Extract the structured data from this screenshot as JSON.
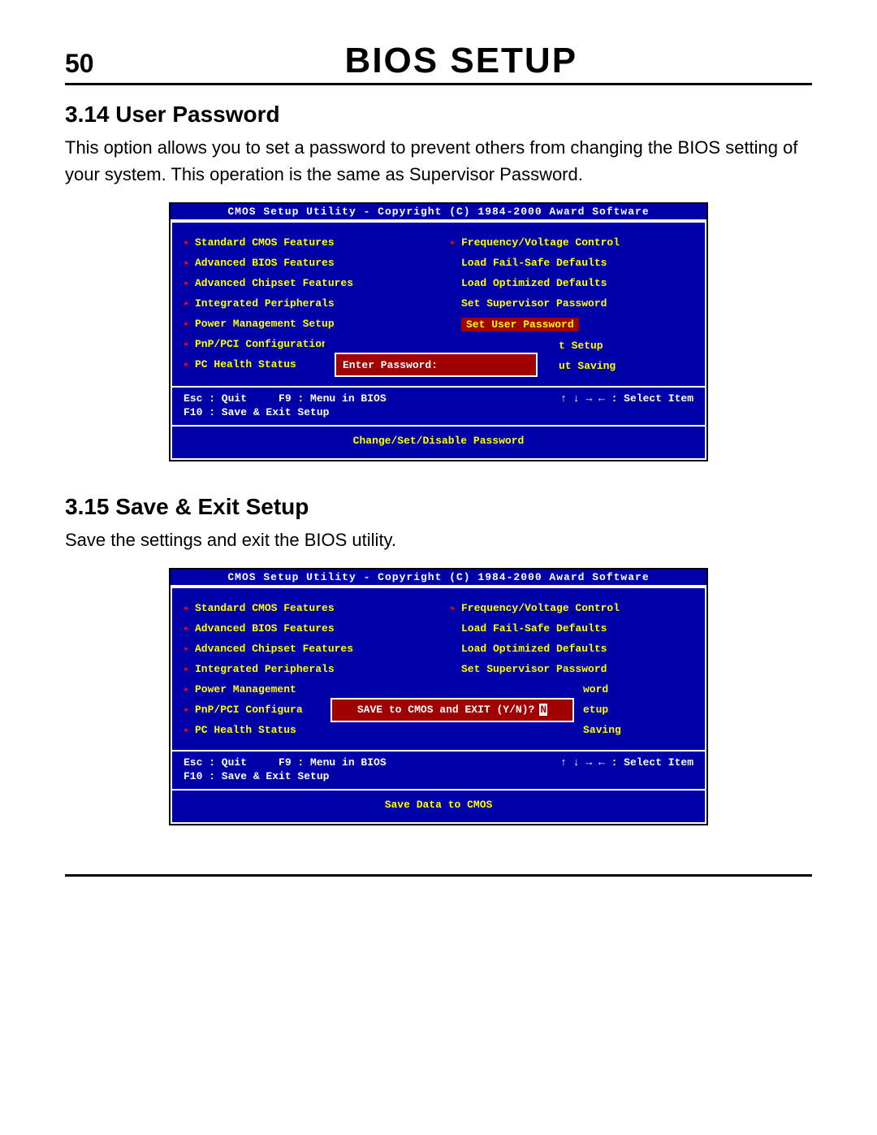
{
  "page": {
    "number": "50",
    "title": "BIOS SETUP"
  },
  "s314": {
    "title": "3.14 User Password",
    "body": "This option allows you to set a password to prevent others from changing the BIOS setting of your system. This operation is the same as Supervisor Password."
  },
  "s315": {
    "title": "3.15 Save & Exit Setup",
    "body": "Save the settings and exit the BIOS utility."
  },
  "bios": {
    "title": "CMOS Setup Utility - Copyright (C) 1984-2000 Award Software",
    "left": [
      "Standard CMOS Features",
      "Advanced BIOS Features",
      "Advanced Chipset Features",
      "Integrated Peripherals",
      "Power Management Setup",
      "PnP/PCI Configurations",
      "PC Health Status"
    ],
    "left_short5": "Power Management",
    "left_short6": "PnP/PCI Configura",
    "right": [
      "Frequency/Voltage Control",
      "Load Fail-Safe Defaults",
      "Load Optimized Defaults",
      "Set Supervisor Password",
      "Set User Password",
      "Save & Exit Setup",
      "Exit Without Saving"
    ],
    "right_trunc": {
      "r5": "t Setup",
      "r6": "ut Saving",
      "r4b": "word",
      "r5b": "etup",
      "r6b": "aving"
    },
    "keys": {
      "left": "Esc : Quit     F9 : Menu in BIOS\nF10 : Save & Exit Setup",
      "right": "↑ ↓ → ←   : Select Item"
    },
    "footer1": "Change/Set/Disable Password",
    "footer2": "Save Data to CMOS",
    "dialog1": "Enter Password:",
    "dialog2": "SAVE to CMOS and EXIT (Y/N)?",
    "dialog2_cursor": "N",
    "saving_suffix": "aving"
  }
}
